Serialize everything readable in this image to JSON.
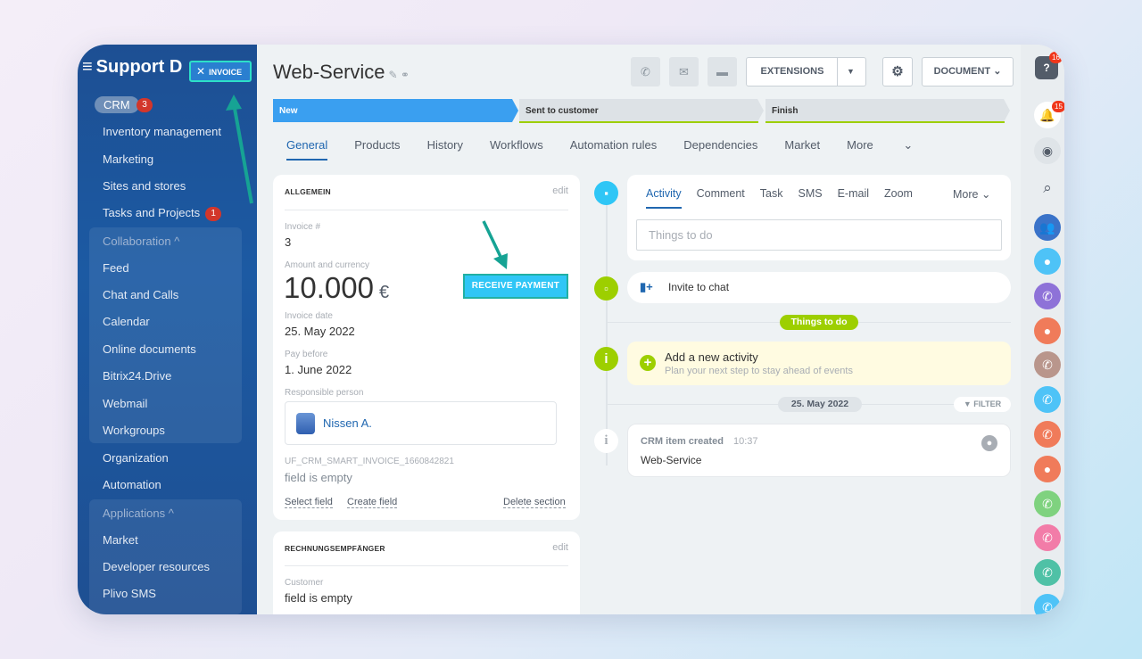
{
  "sidebar": {
    "menu_icon": "menu-icon",
    "title": "Support D",
    "invoice_chip": "INVOICE",
    "crm_label": "CRM",
    "crm_count": "3",
    "items": [
      {
        "label": "Inventory management"
      },
      {
        "label": "Marketing"
      },
      {
        "label": "Sites and stores"
      },
      {
        "label": "Tasks and Projects",
        "badge": "1"
      },
      {
        "label": "Collaboration ^"
      },
      {
        "label": "Feed"
      },
      {
        "label": "Chat and Calls"
      },
      {
        "label": "Calendar"
      },
      {
        "label": "Online documents"
      },
      {
        "label": "Bitrix24.Drive"
      },
      {
        "label": "Webmail"
      },
      {
        "label": "Workgroups"
      },
      {
        "label": "Organization"
      },
      {
        "label": "Automation"
      },
      {
        "label": "Applications ^"
      },
      {
        "label": "Market"
      },
      {
        "label": "Developer resources"
      },
      {
        "label": "Plivo SMS"
      }
    ]
  },
  "header": {
    "title": "Web-Service",
    "extensions": "EXTENSIONS",
    "document": "DOCUMENT"
  },
  "stages": [
    {
      "label": "New",
      "color": "#3a9ff0"
    },
    {
      "label": "Sent to customer",
      "color": "#dde2e6"
    },
    {
      "label": "Finish",
      "color": "#dde2e6"
    }
  ],
  "tabs": [
    "General",
    "Products",
    "History",
    "Workflows",
    "Automation rules",
    "Dependencies",
    "Market",
    "More"
  ],
  "card_general": {
    "title": "ALLGEMEIN",
    "edit": "edit",
    "invoice_label": "Invoice #",
    "invoice_value": "3",
    "amount_label": "Amount and currency",
    "amount_value": "10.000",
    "currency": "€",
    "receive_payment": "RECEIVE PAYMENT",
    "date_label": "Invoice date",
    "date_value": "25. May 2022",
    "pay_label": "Pay before",
    "pay_value": "1. June 2022",
    "resp_label": "Responsible person",
    "resp_value": "Nissen A.",
    "uf_label": "UF_CRM_SMART_INVOICE_1660842821",
    "uf_value": "field is empty",
    "select_field": "Select field",
    "create_field": "Create field",
    "delete_section": "Delete section"
  },
  "card_recipient": {
    "title": "RECHNUNGSEMPFÄNGER",
    "edit": "edit",
    "customer_label": "Customer",
    "customer_value": "field is empty"
  },
  "activity": {
    "tabs": [
      "Activity",
      "Comment",
      "Task",
      "SMS",
      "E-mail",
      "Zoom",
      "More"
    ],
    "placeholder": "Things to do",
    "invite": "Invite to chat",
    "things_pill": "Things to do",
    "add_title": "Add a new activity",
    "add_sub": "Plan your next step to stay ahead of events",
    "date_pill": "25. May 2022",
    "filter": "FILTER",
    "created_title": "CRM item created",
    "created_time": "10:37",
    "created_value": "Web-Service"
  },
  "rail": {
    "help_badge": "16",
    "bell_badge": "15"
  },
  "colors": {
    "accent": "#2067b0",
    "sidebar": "#1d4f93",
    "pay_button": "#2fc6f6",
    "annotation_arrow": "#16a394",
    "green": "#9dcf00"
  }
}
